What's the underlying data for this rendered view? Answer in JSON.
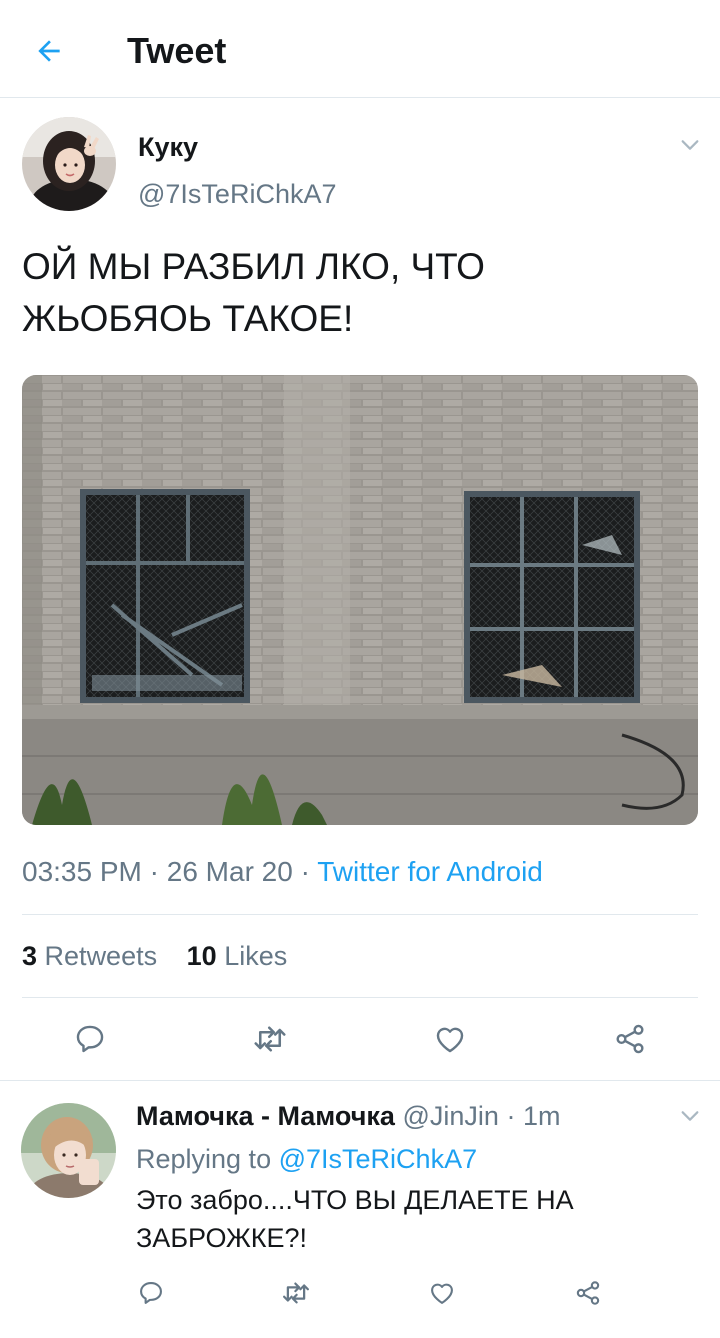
{
  "header": {
    "title": "Tweet",
    "back_icon": "arrow-left-icon"
  },
  "tweet": {
    "author_name": "Куку",
    "author_handle": "@7IsTeRiChkA7",
    "text_line1": "ОЙ МЫ РАЗБИЛ  ЛКО, ЧТО",
    "text_line2": "ЖЬОБЯОЬ ТАКОЕ!",
    "time": "03:35 PM",
    "date": "26 Mar 20",
    "source": "Twitter for Android",
    "retweets_count": "3",
    "retweets_label": "Retweets",
    "likes_count": "10",
    "likes_label": "Likes"
  },
  "reply": {
    "name": "Мамочка - Мамочка",
    "handle": "@JinJin",
    "time": "1m",
    "replying_label": "Replying to",
    "replying_handle": "@7IsTeRiChkA7",
    "text_line1": "Это забро....ЧТО ВЫ ДЕЛАЕТЕ НА",
    "text_line2": "ЗАБРОЖКЕ?!"
  },
  "colors": {
    "accent": "#1da1f2",
    "secondary_text": "#657786",
    "border": "#e1e8ed"
  },
  "icons": [
    "arrow-left-icon",
    "chevron-down-icon",
    "reply-icon",
    "retweet-icon",
    "like-icon",
    "share-icon"
  ]
}
